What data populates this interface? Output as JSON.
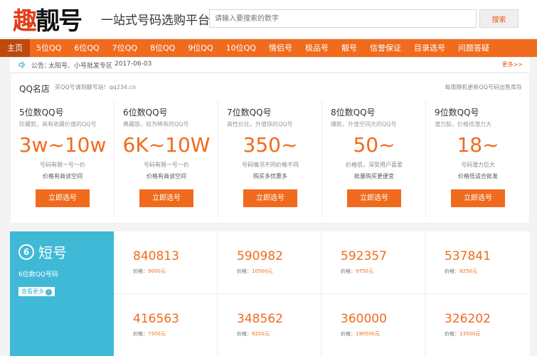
{
  "header": {
    "logo_prefix": "趣",
    "logo_suffix": "靓号",
    "slogan": "一站式号码选购平台",
    "search_placeholder": "请输入要搜索的数字",
    "search_button": "搜索"
  },
  "nav": {
    "items": [
      {
        "label": "主页"
      },
      {
        "label": "5位QQ"
      },
      {
        "label": "6位QQ"
      },
      {
        "label": "7位QQ"
      },
      {
        "label": "8位QQ"
      },
      {
        "label": "9位QQ"
      },
      {
        "label": "10位QQ"
      },
      {
        "label": "情侣号"
      },
      {
        "label": "极品号"
      },
      {
        "label": "靓号"
      },
      {
        "label": "信誉保证"
      },
      {
        "label": "目录选号"
      },
      {
        "label": "问题答疑"
      }
    ],
    "active_index": 0
  },
  "notice": {
    "label": "公告：",
    "text": "太阳号、小号批发专区",
    "date": "2017-06-03",
    "more": "更多>>"
  },
  "qq_shop": {
    "title": "QQ名店",
    "subtitle": "买QQ号请到靓号站！qq234.cn",
    "right_text": "每周随机更新QQ号码出售库存",
    "cards": [
      {
        "title": "5位数QQ号",
        "desc": "珍藏款，具有收藏价值的QQ号",
        "price": "3w~10w",
        "note1": "号码有限一号一价",
        "note2": "价格有商谈空间",
        "button": "立即选号"
      },
      {
        "title": "6位数QQ号",
        "desc": "典藏版，较为稀有的QQ号",
        "price": "6K~10W",
        "note1": "号码有限一号一价",
        "note2": "价格有商谈空间",
        "button": "立即选号"
      },
      {
        "title": "7位数QQ号",
        "desc": "高性价比，升值快的QQ号",
        "price": "350~",
        "note1": "号码情况不同价格不同",
        "note2": "购买多优惠多",
        "button": "立即选号"
      },
      {
        "title": "8位数QQ号",
        "desc": "爆款，升值空间大的QQ号",
        "price": "50~",
        "note1": "价格低，深受用户喜爱",
        "note2": "批量购买更便宜",
        "button": "立即选号"
      },
      {
        "title": "9位数QQ号",
        "desc": "潜力股，价格低潜力大",
        "price": "18~",
        "note1": "号码潜力巨大",
        "note2": "价格低适合批发",
        "button": "立即选号"
      }
    ]
  },
  "short_numbers": {
    "badge": "6",
    "title": "短号",
    "subtitle": "6位数QQ号码",
    "more": "查看更多",
    "more_arrow": "›",
    "price_label": "价格：",
    "items": [
      {
        "number": "840813",
        "price": "9000元"
      },
      {
        "number": "590982",
        "price": "10500元"
      },
      {
        "number": "592357",
        "price": "9750元"
      },
      {
        "number": "537841",
        "price": "8250元"
      },
      {
        "number": "416563",
        "price": "7500元"
      },
      {
        "number": "348562",
        "price": "8250元"
      },
      {
        "number": "360000",
        "price": "190500元"
      },
      {
        "number": "326202",
        "price": "13500元"
      }
    ]
  },
  "colors": {
    "accent": "#f06b1e",
    "nav_active": "#bd4a0c",
    "short_panel": "#3fb9d6"
  }
}
